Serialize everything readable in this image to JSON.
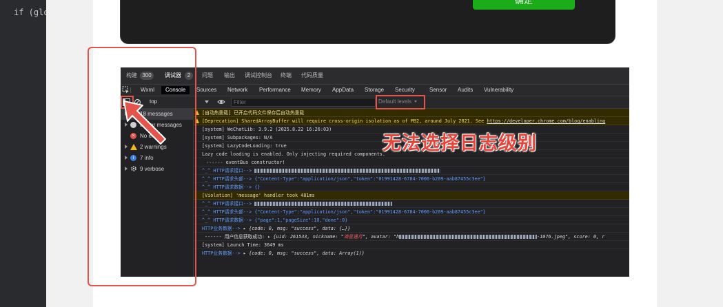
{
  "editor": {
    "code": "if (globa"
  },
  "phone": {
    "confirm_label": "确定"
  },
  "top_tabs": [
    {
      "label": "构建"
    },
    {
      "label": "300"
    },
    {
      "label": "调试器"
    },
    {
      "label": "2"
    },
    {
      "label": "问题"
    },
    {
      "label": "输出"
    },
    {
      "label": "调试控制台"
    },
    {
      "label": "终端"
    },
    {
      "label": "代码质量"
    }
  ],
  "panel_tabs": [
    "Wxml",
    "Console",
    "Sources",
    "Network",
    "Performance",
    "Memory",
    "AppData",
    "Storage",
    "Security",
    "Sensor",
    "Audits",
    "Vulnerability"
  ],
  "filter_bar": {
    "context": "top",
    "filter_placeholder": "Filter",
    "levels": "Default levels"
  },
  "sidebar": {
    "items": [
      {
        "label": "18 messages",
        "icon": "list-icon"
      },
      {
        "label": "8 user messages",
        "icon": "user-icon"
      },
      {
        "label": "No errors",
        "icon": "error-icon"
      },
      {
        "label": "2 warnings",
        "icon": "warning-icon"
      },
      {
        "label": "7 info",
        "icon": "info-icon"
      },
      {
        "label": "9 verbose",
        "icon": "verbose-icon"
      }
    ]
  },
  "log": {
    "l1": "[自动热重载] 已开启代码文件保存后自动热重载",
    "l2": "[Deprecation] SharedArrayBuffer will require cross-origin isolation as of M92, around July 2021. See ",
    "l2_link": "https://developer.chrome.com/blog/enabling",
    "l3": "[system] WeChatLib: 3.9.2 (2025.8.22 16:26:03)",
    "l4": "[system] Subpackages: N/A",
    "l5": "[system] LazyCodeLoading: true",
    "l6": "Lazy code loading is enabled. Only injecting required components.",
    "l7": "------ eventBus constructor!",
    "l8": "^_^ HTTP请求接口-->",
    "l9": "^_^ HTTP请求头部--> {\"Content-Type\":\"application/json\",\"token\":\"01991428-6784-7000-b209-aab87455c3ee\"}",
    "l10": "^_^ HTTP请求数据--> {}",
    "l11": "[Violation] 'message' handler took 481ms",
    "l12": "^_^ HTTP请求接口-->",
    "l13": "^_^ HTTP请求头部--> {\"Content-Type\":\"application/json\",\"token\":\"01991428-6784-7000-b209-aab87455c3ee\"}",
    "l14": "^_^ HTTP请求数据--> {\"page\":1,\"pageSize\":10,\"done\":0}",
    "l15_prefix": "HTTP业务数据-->",
    "l15_obj": "{code: 0, msg: \"success\", data: {…}}",
    "l16_prefix": "------ 用户信息获取成功:",
    "l16_obj": "{uid: 261533, nickname: \"",
    "l16_name": "滴星遇月",
    "l16_rest": "\", avatar: \"h",
    "l16_tail": "-1076.jpeg\", score: 0, r",
    "l17": "[system] Launch Time: 3649 ms",
    "l18_prefix": "HTTP业务数据-->",
    "l18_obj": "{code: 0, msg: \"success\", data: Array(1)}"
  },
  "annotation": "无法选择日志级别",
  "colors": {
    "highlight": "#e5544b",
    "arrow": "#e5544b",
    "annotation": "#e8443a"
  }
}
